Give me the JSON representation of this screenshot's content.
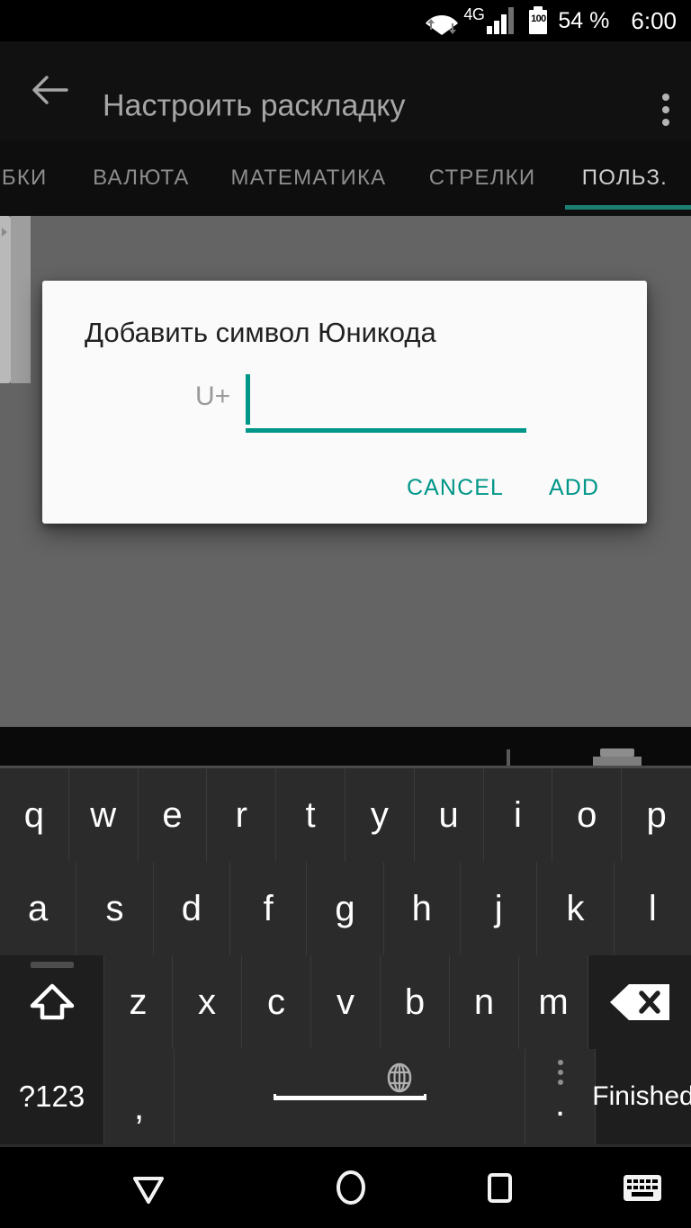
{
  "statusbar": {
    "wifi_icon": "wifi-icon",
    "network_label": "4G",
    "signal_icon": "signal-bars-icon",
    "battery_level_text": "100",
    "battery_percent": "54 %",
    "clock": "6:00"
  },
  "appbar": {
    "back_icon": "back-arrow-icon",
    "title": "Настроить раскладку",
    "overflow_icon": "overflow-menu-icon"
  },
  "tabs": {
    "items": [
      {
        "label": "ОБКИ",
        "active": false
      },
      {
        "label": "ВАЛЮТА",
        "active": false
      },
      {
        "label": "МАТЕМАТИКА",
        "active": false
      },
      {
        "label": "СТРЕЛКИ",
        "active": false
      },
      {
        "label": "ПОЛЬЗ.",
        "active": true
      }
    ],
    "indicator_color": "#1d7f73"
  },
  "dialog": {
    "title": "Добавить символ Юникода",
    "input_prefix": "U+",
    "input_value": "",
    "input_placeholder": "",
    "accent_color": "#009688",
    "cancel_label": "CANCEL",
    "add_label": "ADD"
  },
  "keyboard": {
    "row1": [
      "q",
      "w",
      "e",
      "r",
      "t",
      "y",
      "u",
      "i",
      "o",
      "p"
    ],
    "row2": [
      "a",
      "s",
      "d",
      "f",
      "g",
      "h",
      "j",
      "k",
      "l"
    ],
    "row3_shift": "shift-icon",
    "row3": [
      "z",
      "x",
      "c",
      "v",
      "b",
      "n",
      "m"
    ],
    "row3_backspace": "backspace-icon",
    "row4": {
      "symbols_label": "?123",
      "comma_label": ",",
      "space_globe_icon": "globe-icon",
      "space_label": "",
      "period_label": ".",
      "period_menu_icon": "more-dots-icon",
      "action_label": "Finished"
    }
  },
  "navbar": {
    "back_icon": "nav-back-triangle-icon",
    "home_icon": "nav-home-circle-icon",
    "recents_icon": "nav-recents-square-icon",
    "keyboard_icon": "nav-keyboard-icon"
  }
}
